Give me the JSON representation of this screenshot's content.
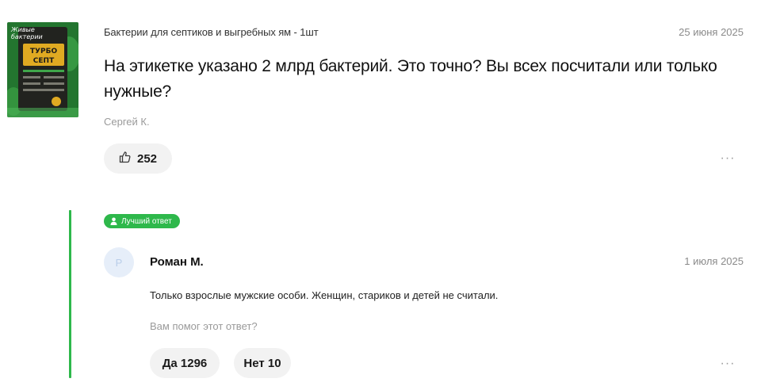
{
  "question": {
    "product_name": "Бактерии для септиков и выгребных ям - 1шт",
    "date": "25 июня 2025",
    "text": "На этикетке указано 2 млрд бактерий. Это точно? Вы всех посчитали или только нужные?",
    "author": "Сергей К.",
    "likes": "252",
    "more_label": "···"
  },
  "product_image": {
    "line1": "Живые",
    "line2": "бактерии",
    "brand1": "ТУРБО",
    "brand2": "СЕПТ",
    "colors": {
      "background": "#1f6b2b",
      "label": "#e0aa22",
      "dark": "#22231f"
    }
  },
  "answer": {
    "badge": "Лучший ответ",
    "avatar_letter": "Р",
    "author": "Роман М.",
    "date": "1 июля 2025",
    "text": "Только взрослые мужские особи. Женщин, стариков и детей не считали.",
    "helpful_question": "Вам помог этот ответ?",
    "yes_label": "Да 1296",
    "no_label": "Нет 10",
    "more_label": "···"
  },
  "colors": {
    "accent": "#2eb84b",
    "pill_bg": "#f2f2f2",
    "muted": "#9a9a9a"
  }
}
